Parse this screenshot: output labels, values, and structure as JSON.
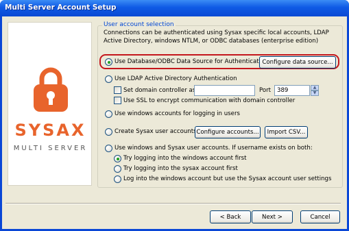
{
  "window": {
    "title": "Multi Server Account Setup"
  },
  "logo": {
    "brand": "SYSAX",
    "subtitle": "MULTI SERVER",
    "accent_color": "#e8642c"
  },
  "group": {
    "title": "User account selection",
    "description": "Connections can be authenticated using Sysax specific local accounts, LDAP Active Directory, windows NTLM, or ODBC databases (enterprise edition)"
  },
  "options": {
    "database": {
      "label": "Use Database/ODBC Data Source for Authentication",
      "checked": true,
      "button": "Configure data source..."
    },
    "ldap": {
      "label": "Use LDAP Active Directory Authentication",
      "set_dc_label": "Set domain controller as",
      "dc_value": "",
      "port_label": "Port",
      "port_value": "389",
      "ssl_label": "Use SSL to encrypt communication with domain controller"
    },
    "windows": {
      "label": "Use windows accounts for logging in users"
    },
    "sysax": {
      "label": "Create Sysax user accounts",
      "configure_button": "Configure accounts...",
      "import_button": "Import CSV..."
    },
    "both": {
      "label": "Use windows and Sysax user accounts. If username exists on both:",
      "sub": [
        {
          "label": "Try logging into the windows account first",
          "checked": true
        },
        {
          "label": "Try logging into the sysax account first",
          "checked": false
        },
        {
          "label": "Log into the windows account but use the Sysax account user settings",
          "checked": false
        }
      ]
    }
  },
  "footer": {
    "back": "< Back",
    "next": "Next >",
    "cancel": "Cancel"
  }
}
